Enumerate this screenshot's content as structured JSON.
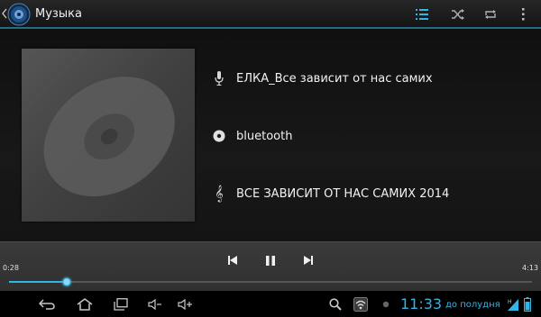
{
  "app": {
    "title": "Музыка"
  },
  "colors": {
    "accent": "#33b5e5",
    "bar": "#303030",
    "background": "#141414"
  },
  "action_bar": {
    "icons": [
      "up-caret-icon",
      "music-app-icon",
      "playlist-icon",
      "shuffle-icon",
      "repeat-icon",
      "overflow-menu-icon"
    ]
  },
  "track": {
    "title": "ЕЛКА_Все зависит от нас самих",
    "artist": "bluetooth",
    "album": "ВСЕ ЗАВИСИТ ОТ НАС САМИХ 2014"
  },
  "playback": {
    "current_time": "0:28",
    "total_time": "4:13",
    "progress_fraction": 0.11,
    "state": "playing"
  },
  "system_bar": {
    "time": "11:33",
    "am_pm": "до полудня",
    "icons": [
      "back-icon",
      "home-icon",
      "recent-apps-icon",
      "volume-down-icon",
      "volume-up-icon",
      "search-icon",
      "wifi-notification-icon",
      "status-dot-icon",
      "signal-icon",
      "battery-icon"
    ]
  }
}
